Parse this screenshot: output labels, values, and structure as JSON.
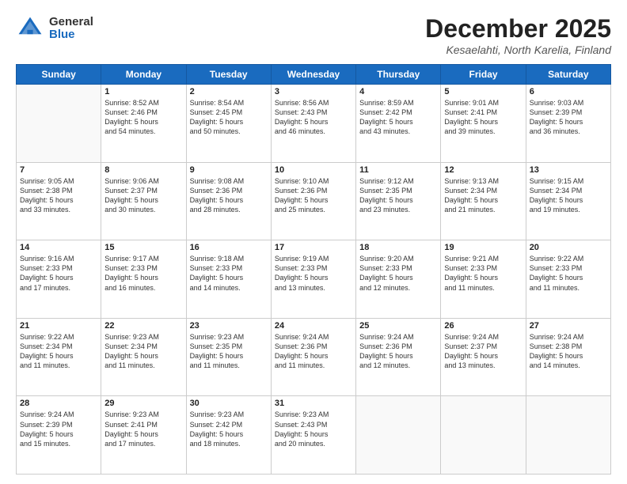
{
  "logo": {
    "general": "General",
    "blue": "Blue"
  },
  "header": {
    "month": "December 2025",
    "location": "Kesaelahti, North Karelia, Finland"
  },
  "weekdays": [
    "Sunday",
    "Monday",
    "Tuesday",
    "Wednesday",
    "Thursday",
    "Friday",
    "Saturday"
  ],
  "weeks": [
    [
      {
        "day": "",
        "info": ""
      },
      {
        "day": "1",
        "info": "Sunrise: 8:52 AM\nSunset: 2:46 PM\nDaylight: 5 hours\nand 54 minutes."
      },
      {
        "day": "2",
        "info": "Sunrise: 8:54 AM\nSunset: 2:45 PM\nDaylight: 5 hours\nand 50 minutes."
      },
      {
        "day": "3",
        "info": "Sunrise: 8:56 AM\nSunset: 2:43 PM\nDaylight: 5 hours\nand 46 minutes."
      },
      {
        "day": "4",
        "info": "Sunrise: 8:59 AM\nSunset: 2:42 PM\nDaylight: 5 hours\nand 43 minutes."
      },
      {
        "day": "5",
        "info": "Sunrise: 9:01 AM\nSunset: 2:41 PM\nDaylight: 5 hours\nand 39 minutes."
      },
      {
        "day": "6",
        "info": "Sunrise: 9:03 AM\nSunset: 2:39 PM\nDaylight: 5 hours\nand 36 minutes."
      }
    ],
    [
      {
        "day": "7",
        "info": "Sunrise: 9:05 AM\nSunset: 2:38 PM\nDaylight: 5 hours\nand 33 minutes."
      },
      {
        "day": "8",
        "info": "Sunrise: 9:06 AM\nSunset: 2:37 PM\nDaylight: 5 hours\nand 30 minutes."
      },
      {
        "day": "9",
        "info": "Sunrise: 9:08 AM\nSunset: 2:36 PM\nDaylight: 5 hours\nand 28 minutes."
      },
      {
        "day": "10",
        "info": "Sunrise: 9:10 AM\nSunset: 2:36 PM\nDaylight: 5 hours\nand 25 minutes."
      },
      {
        "day": "11",
        "info": "Sunrise: 9:12 AM\nSunset: 2:35 PM\nDaylight: 5 hours\nand 23 minutes."
      },
      {
        "day": "12",
        "info": "Sunrise: 9:13 AM\nSunset: 2:34 PM\nDaylight: 5 hours\nand 21 minutes."
      },
      {
        "day": "13",
        "info": "Sunrise: 9:15 AM\nSunset: 2:34 PM\nDaylight: 5 hours\nand 19 minutes."
      }
    ],
    [
      {
        "day": "14",
        "info": "Sunrise: 9:16 AM\nSunset: 2:33 PM\nDaylight: 5 hours\nand 17 minutes."
      },
      {
        "day": "15",
        "info": "Sunrise: 9:17 AM\nSunset: 2:33 PM\nDaylight: 5 hours\nand 16 minutes."
      },
      {
        "day": "16",
        "info": "Sunrise: 9:18 AM\nSunset: 2:33 PM\nDaylight: 5 hours\nand 14 minutes."
      },
      {
        "day": "17",
        "info": "Sunrise: 9:19 AM\nSunset: 2:33 PM\nDaylight: 5 hours\nand 13 minutes."
      },
      {
        "day": "18",
        "info": "Sunrise: 9:20 AM\nSunset: 2:33 PM\nDaylight: 5 hours\nand 12 minutes."
      },
      {
        "day": "19",
        "info": "Sunrise: 9:21 AM\nSunset: 2:33 PM\nDaylight: 5 hours\nand 11 minutes."
      },
      {
        "day": "20",
        "info": "Sunrise: 9:22 AM\nSunset: 2:33 PM\nDaylight: 5 hours\nand 11 minutes."
      }
    ],
    [
      {
        "day": "21",
        "info": "Sunrise: 9:22 AM\nSunset: 2:34 PM\nDaylight: 5 hours\nand 11 minutes."
      },
      {
        "day": "22",
        "info": "Sunrise: 9:23 AM\nSunset: 2:34 PM\nDaylight: 5 hours\nand 11 minutes."
      },
      {
        "day": "23",
        "info": "Sunrise: 9:23 AM\nSunset: 2:35 PM\nDaylight: 5 hours\nand 11 minutes."
      },
      {
        "day": "24",
        "info": "Sunrise: 9:24 AM\nSunset: 2:36 PM\nDaylight: 5 hours\nand 11 minutes."
      },
      {
        "day": "25",
        "info": "Sunrise: 9:24 AM\nSunset: 2:36 PM\nDaylight: 5 hours\nand 12 minutes."
      },
      {
        "day": "26",
        "info": "Sunrise: 9:24 AM\nSunset: 2:37 PM\nDaylight: 5 hours\nand 13 minutes."
      },
      {
        "day": "27",
        "info": "Sunrise: 9:24 AM\nSunset: 2:38 PM\nDaylight: 5 hours\nand 14 minutes."
      }
    ],
    [
      {
        "day": "28",
        "info": "Sunrise: 9:24 AM\nSunset: 2:39 PM\nDaylight: 5 hours\nand 15 minutes."
      },
      {
        "day": "29",
        "info": "Sunrise: 9:23 AM\nSunset: 2:41 PM\nDaylight: 5 hours\nand 17 minutes."
      },
      {
        "day": "30",
        "info": "Sunrise: 9:23 AM\nSunset: 2:42 PM\nDaylight: 5 hours\nand 18 minutes."
      },
      {
        "day": "31",
        "info": "Sunrise: 9:23 AM\nSunset: 2:43 PM\nDaylight: 5 hours\nand 20 minutes."
      },
      {
        "day": "",
        "info": ""
      },
      {
        "day": "",
        "info": ""
      },
      {
        "day": "",
        "info": ""
      }
    ]
  ]
}
